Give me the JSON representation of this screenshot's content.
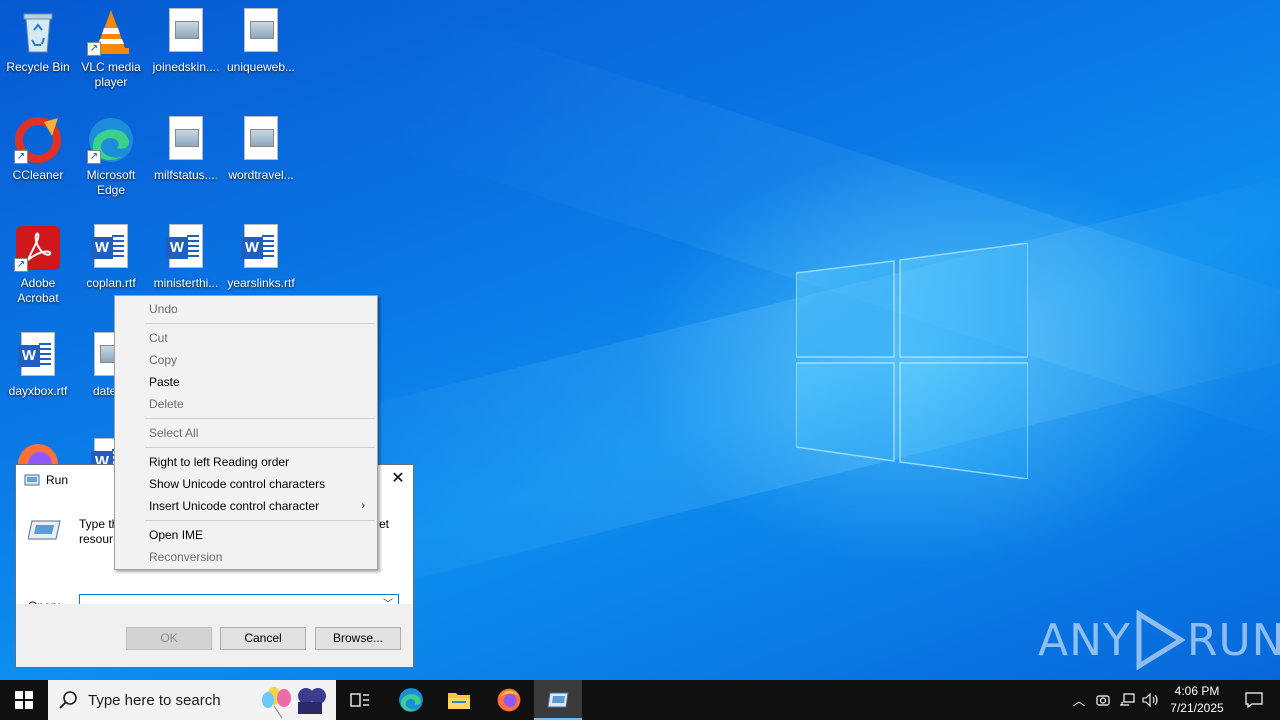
{
  "desktop": {
    "icons": [
      {
        "label": "Recycle Bin",
        "icon": "recycle-bin-icon"
      },
      {
        "label": "VLC media player",
        "icon": "vlc-icon"
      },
      {
        "label": "joinedskin....",
        "icon": "image-file-icon"
      },
      {
        "label": "uniqueweb...",
        "icon": "image-file-icon"
      },
      {
        "label": "CCleaner",
        "icon": "ccleaner-icon"
      },
      {
        "label": "Microsoft Edge",
        "icon": "edge-icon"
      },
      {
        "label": "milfstatus....",
        "icon": "image-file-icon"
      },
      {
        "label": "wordtravel...",
        "icon": "image-file-icon"
      },
      {
        "label": "Adobe Acrobat",
        "icon": "acrobat-icon"
      },
      {
        "label": "coplan.rtf",
        "icon": "word-doc-icon"
      },
      {
        "label": "ministerthi...",
        "icon": "word-doc-icon"
      },
      {
        "label": "yearslinks.rtf",
        "icon": "word-doc-icon"
      },
      {
        "label": "dayxbox.rtf",
        "icon": "word-doc-icon"
      },
      {
        "label": "datech",
        "icon": "image-file-icon"
      }
    ]
  },
  "run_dialog": {
    "title": "Run",
    "description_left": "Type th",
    "description_left_2": "resour",
    "description_right": "et",
    "open_label": "Open:",
    "open_value": "",
    "ok_label": "OK",
    "cancel_label": "Cancel",
    "browse_label": "Browse..."
  },
  "context_menu": {
    "items": [
      {
        "label": "Undo",
        "enabled": false
      },
      {
        "label": "Cut",
        "enabled": false
      },
      {
        "label": "Copy",
        "enabled": false
      },
      {
        "label": "Paste",
        "enabled": true
      },
      {
        "label": "Delete",
        "enabled": false
      },
      {
        "label": "Select All",
        "enabled": false
      },
      {
        "label": "Right to left Reading order",
        "enabled": true
      },
      {
        "label": "Show Unicode control characters",
        "enabled": true
      },
      {
        "label": "Insert Unicode control character",
        "enabled": true,
        "submenu": true
      },
      {
        "label": "Open IME",
        "enabled": true
      },
      {
        "label": "Reconversion",
        "enabled": false
      }
    ]
  },
  "watermark": {
    "left": "ANY",
    "right": "RUN"
  },
  "taskbar": {
    "search_placeholder": "Type here to search",
    "pinned": [
      "task-view",
      "microsoft-edge",
      "file-explorer",
      "firefox",
      "run"
    ],
    "time": "4:06 PM",
    "date": "7/21/2025"
  },
  "colors": {
    "accent": "#0078d7",
    "taskbar": "#101010",
    "wallpaper": "#0a63d6"
  }
}
